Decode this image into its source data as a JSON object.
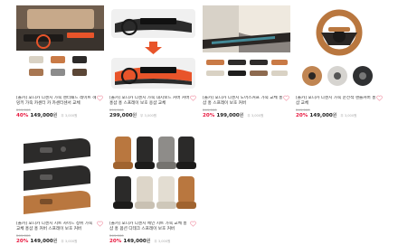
{
  "products": [
    {
      "title": "[올카] 포니카 디젠치 가죽 센터패드 레이트 헤밍키 가죽 카센터 카 카센터센서 교체",
      "original_price": "299,000",
      "discount": "40%",
      "price": "149,000",
      "currency": "원",
      "shipping": "무 3,000원"
    },
    {
      "title": "[올카] 포니카 디젠치 가죽 대시보드 커버 커버 홍샵 홍 스프레이 보호 용샵 교체",
      "original_price": "299,000",
      "discount": "",
      "price": "299,000",
      "currency": "원",
      "shipping": "무 3,000원"
    },
    {
      "title": "[올카] 포니카 디젠치 도어스커프 가죽 교체 홍샵 홍 스프레이 보호 커버",
      "original_price": "249,000",
      "discount": "20%",
      "price": "199,000",
      "currency": "원",
      "shipping": "무 3,000원"
    },
    {
      "title": "[올카] 포니카 디젠치 가죽 운전석 핸들커버 홍샵 교체",
      "original_price": "249,000",
      "discount": "20%",
      "price": "149,000",
      "currency": "원",
      "shipping": "무 3,000원"
    },
    {
      "title": "[올카] 포니카 디젠치 시트 사이드 정위 가죽 교체 홍샵 홍 커버 스프레이 보호 커버",
      "original_price": "249,000",
      "discount": "20%",
      "price": "149,000",
      "currency": "원",
      "shipping": "무 3,000원"
    },
    {
      "title": "[올카] 포니카 디젠치 메인 시트 가죽 교체 홍샵 홍 옵션 디테크 스프레이 보호 커버",
      "original_price": "249,000",
      "discount": "20%",
      "price": "149,000",
      "currency": "원",
      "shipping": "무 3,000원"
    }
  ],
  "colors": {
    "discount": "#e8183f",
    "heart": "#f3a4b4",
    "accent_orange": "#e8542a",
    "leather_brown": "#b9773f"
  },
  "icons": {
    "wishlist": "heart-outline-icon",
    "arrow": "arrow-down-icon"
  }
}
